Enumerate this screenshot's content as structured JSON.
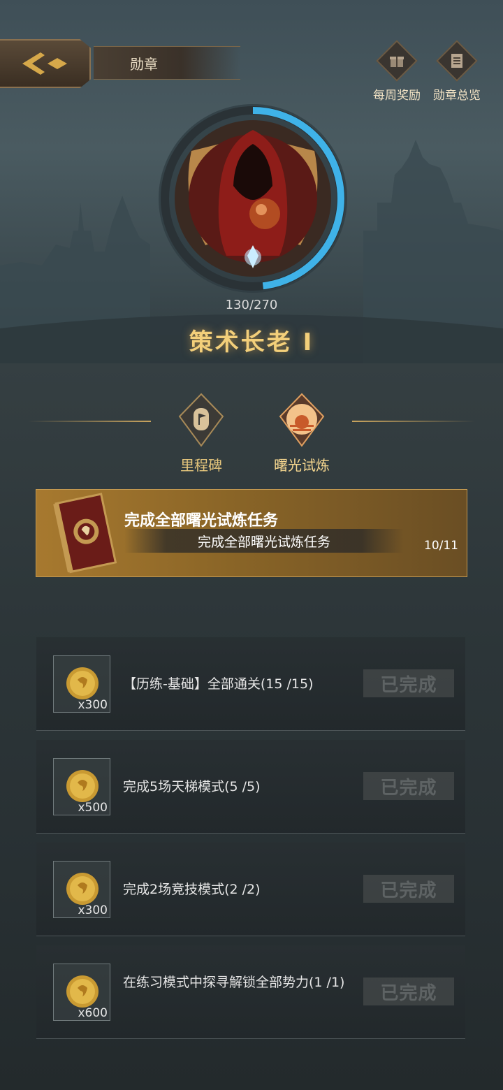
{
  "header": {
    "title": "勋章",
    "weekly_reward_label": "每周奖励",
    "overview_label": "勋章总览"
  },
  "badge": {
    "progress_text": "130/270",
    "progress": 0.4815,
    "rank_name": "策术长老 I"
  },
  "tabs": [
    {
      "label": "里程碑",
      "active": false
    },
    {
      "label": "曙光试炼",
      "active": true
    }
  ],
  "quest": {
    "title": "完成全部曙光试炼任务",
    "subtitle": "完成全部曙光试炼任务",
    "count": "10/11"
  },
  "tasks": [
    {
      "reward_qty": "x300",
      "text": "【历练-基础】全部通关(15 /15)",
      "status": "已完成"
    },
    {
      "reward_qty": "x500",
      "text": "完成5场天梯模式(5 /5)",
      "status": "已完成"
    },
    {
      "reward_qty": "x300",
      "text": "完成2场竞技模式(2 /2)",
      "status": "已完成"
    },
    {
      "reward_qty": "x600",
      "text": "在练习模式中探寻解锁全部势力(1 /1)",
      "status": "已完成"
    }
  ],
  "colors": {
    "gold": "#f3cf7a",
    "progress_blue": "#3fb2e8",
    "banner_gold": "#a7792f"
  }
}
